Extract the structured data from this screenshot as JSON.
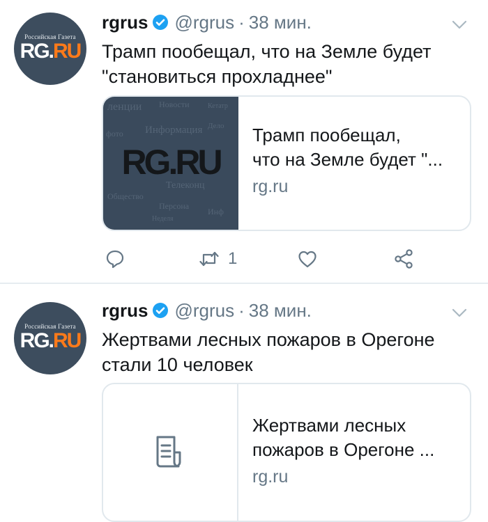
{
  "colors": {
    "accent": "#1da1f2",
    "text": "#14171a",
    "muted": "#657786",
    "border": "#e1e8ed",
    "brand_orange": "#ff7a1a"
  },
  "tweets": [
    {
      "user_name": "rgrus",
      "handle": "@rgrus",
      "separator": "·",
      "time": "38 мин.",
      "avatar": {
        "caption": "Российская Газета",
        "logo_rg": "RG",
        "logo_dot": ".",
        "logo_ru": "RU"
      },
      "text": "Трамп пообещал, что на Земле будет \"становиться прохладнее\"",
      "card": {
        "media_type": "image",
        "logo_rg": "RG",
        "logo_dot": ".",
        "logo_ru": "RU",
        "title_line1": "Трамп пообещал,",
        "title_line2": "что на Земле будет \"...",
        "domain": "rg.ru"
      },
      "actions": {
        "reply_icon": "reply-icon",
        "retweet_icon": "retweet-icon",
        "retweet_count": "1",
        "like_icon": "heart-icon",
        "share_icon": "share-icon"
      }
    },
    {
      "user_name": "rgrus",
      "handle": "@rgrus",
      "separator": "·",
      "time": "38 мин.",
      "avatar": {
        "caption": "Российская Газета",
        "logo_rg": "RG",
        "logo_dot": ".",
        "logo_ru": "RU"
      },
      "text": "Жертвами лесных пожаров в Орегоне стали 10 человек",
      "card": {
        "media_type": "document-placeholder",
        "placeholder_icon": "document-icon",
        "title_line1": "Жертвами лесных",
        "title_line2": "пожаров в Орегоне ...",
        "domain": "rg.ru"
      }
    }
  ]
}
